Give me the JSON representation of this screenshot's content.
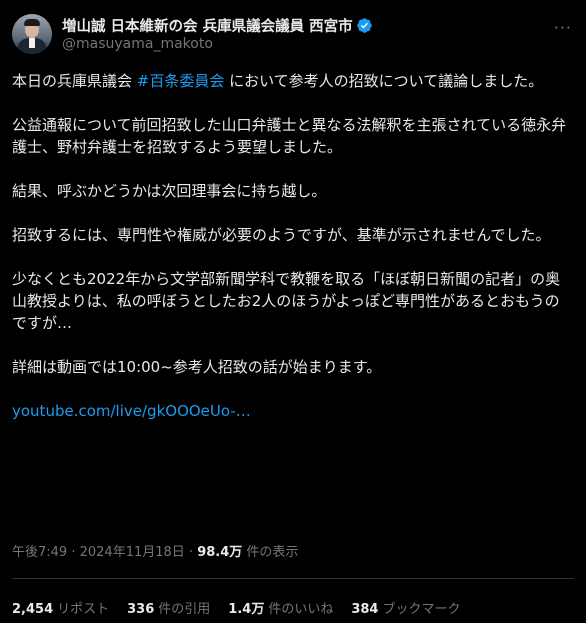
{
  "author": {
    "name": "増山誠 日本維新の会 兵庫県議会議員 西宮市",
    "handle": "@masuyama_makoto",
    "verified_color": "#1d9bf0"
  },
  "tweet": {
    "p1_before": "本日の兵庫県議会 ",
    "p1_hashtag": "#百条委員会",
    "p1_after": " において参考人の招致について議論しました。",
    "p2": "公益通報について前回招致した山口弁護士と異なる法解釈を主張されている徳永弁護士、野村弁護士を招致するよう要望しました。",
    "p3": "結果、呼ぶかどうかは次回理事会に持ち越し。",
    "p4": "招致するには、専門性や権威が必要のようですが、基準が示されませんでした。",
    "p5": "少なくとも2022年から文学部新聞学科で教鞭を取る「ほぼ朝日新聞の記者」の奥山教授よりは、私の呼ぼうとしたお2人のほうがよっぽど専門性があるとおもうのですが…",
    "p6": "詳細は動画では10:00~参考人招致の話が始まります。",
    "link": "youtube.com/live/gkOOOeUo-…"
  },
  "meta": {
    "time": "午後7:49",
    "sep": " · ",
    "date": "2024年11月18日",
    "sep2": " · ",
    "views_count": "98.4万",
    "views_label": " 件の表示"
  },
  "stats": [
    {
      "count": "2,454",
      "label": "リポスト"
    },
    {
      "count": "336",
      "label": "件の引用"
    },
    {
      "count": "1.4万",
      "label": "件のいいね"
    },
    {
      "count": "384",
      "label": "ブックマーク"
    }
  ],
  "colors": {
    "background": "#000000",
    "text": "#e7e9ea",
    "muted": "#71767b",
    "accent": "#1d9bf0",
    "divider": "#2f3336"
  }
}
